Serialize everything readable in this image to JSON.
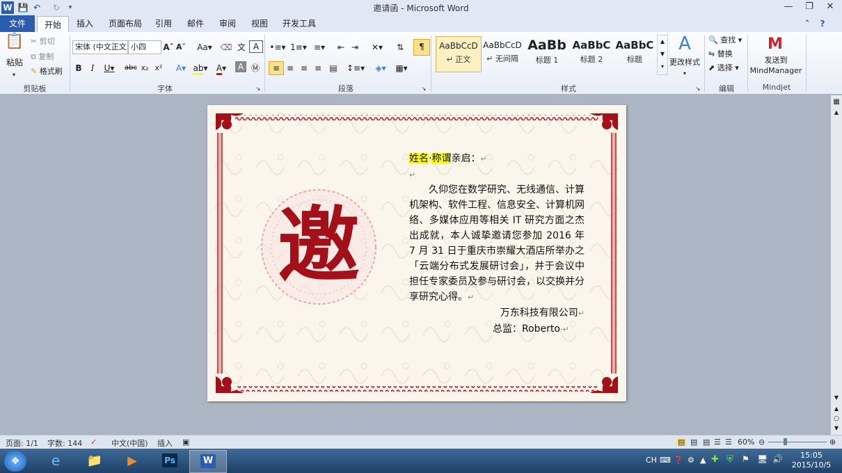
{
  "window": {
    "title": "邀请函 - Microsoft Word"
  },
  "qat": {
    "icons": [
      "word-app-icon",
      "save-icon",
      "undo-icon",
      "redo-icon",
      "customize-icon"
    ]
  },
  "tabs": [
    "文件",
    "开始",
    "插入",
    "页面布局",
    "引用",
    "邮件",
    "审阅",
    "视图",
    "开发工具"
  ],
  "ribbon": {
    "clipboard": {
      "paste": "粘贴",
      "cut": "剪切",
      "copy": "复制",
      "format_painter": "格式刷",
      "label": "剪贴板"
    },
    "font": {
      "font_name": "宋体 (中文正文",
      "font_size": "小四",
      "label": "字体"
    },
    "paragraph": {
      "label": "段落"
    },
    "styles": {
      "label": "样式",
      "items": [
        {
          "sample": "AaBbCcD",
          "name": "↵ 正文"
        },
        {
          "sample": "AaBbCcD",
          "name": "↵ 无间隔"
        },
        {
          "sample": "AaBb",
          "name": "标题 1"
        },
        {
          "sample": "AaBbC",
          "name": "标题 2"
        },
        {
          "sample": "AaBbC",
          "name": "标题"
        }
      ],
      "change_styles": "更改样式"
    },
    "editing": {
      "find": "查找",
      "replace": "替换",
      "select": "选择",
      "label": "编辑"
    },
    "mindjet": {
      "send": "发送到",
      "product": "MindManager",
      "label": "Mindjet"
    }
  },
  "document": {
    "seal_char": "邀",
    "salutation_name": "姓名",
    "salutation_title": "称谓",
    "salutation_tail": "亲启：",
    "body": "久仰您在数学研究、无线通信、计算机架构、软件工程、信息安全、计算机网络、多媒体应用等相关 IT 研究方面之杰出成就，本人诚挚邀请您参加 2016 年 7 月 31 日于重庆市崇耀大酒店所举办之「云端分布式发展研讨会」，并于会议中担任专家委员及参与研讨会，以交换并分享研究心得。",
    "company": "万东科技有限公司",
    "signer": "总监：Roberto"
  },
  "status": {
    "page": "页面: 1/1",
    "words": "字数: 144",
    "language": "中文(中国)",
    "mode": "插入",
    "zoom": "60%"
  },
  "taskbar": {
    "lang": "CH",
    "time": "15:05",
    "date": "2015/10/5"
  },
  "colors": {
    "file_tab": "#2a5db0",
    "border_red": "#b5121b",
    "highlight": "#ffff00"
  }
}
